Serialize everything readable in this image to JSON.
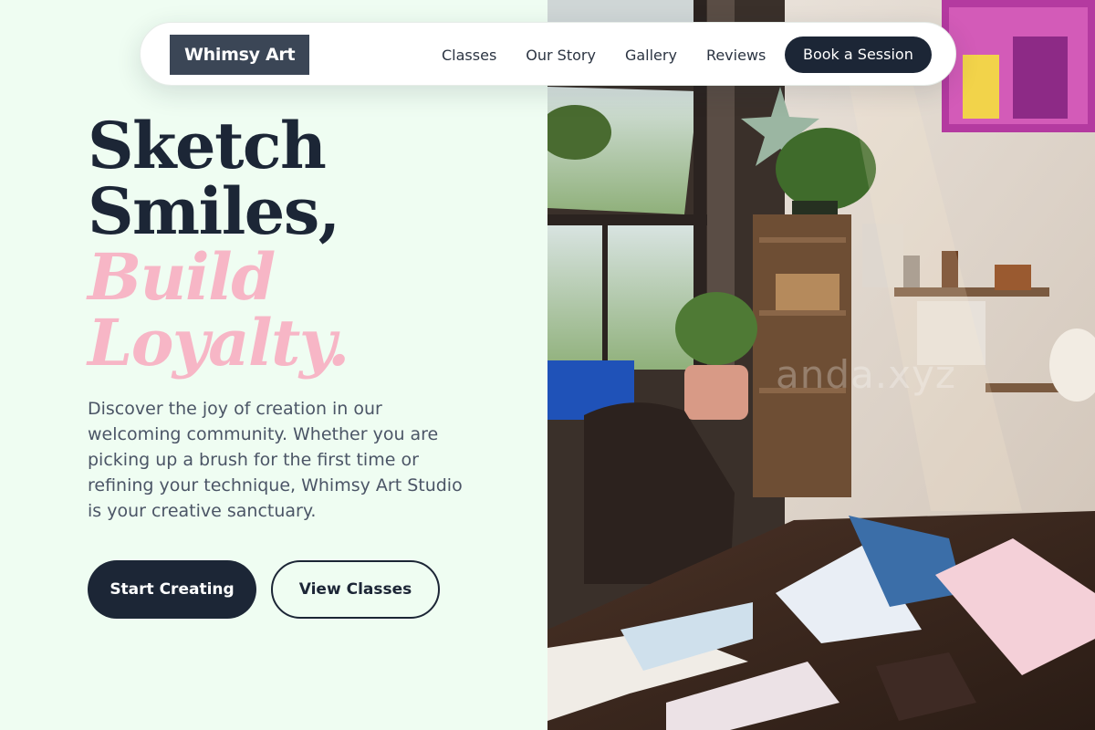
{
  "brand": {
    "logo_text": "Whimsy Art"
  },
  "nav": {
    "links": [
      "Classes",
      "Our Story",
      "Gallery",
      "Reviews"
    ],
    "cta_label": "Book a Session"
  },
  "hero": {
    "headline_line1": "Sketch",
    "headline_line2": "Smiles,",
    "headline_line3": "Build",
    "headline_line4": "Loyalty.",
    "description": "Discover the joy of creation in our welcoming community. Whether you are picking up a brush for the first time or refining your technique, Whimsy Art Studio is your creative sanctuary.",
    "primary_button": "Start Creating",
    "secondary_button": "View Classes"
  },
  "photo": {
    "alt": "art studio photo",
    "watermark": "anda.xyz"
  },
  "colors": {
    "background": "#effdf2",
    "primary_dark": "#1c2636",
    "accent_pink": "#f7b6c6",
    "logo_bg": "#3b4656",
    "body_text": "#4b5566"
  }
}
